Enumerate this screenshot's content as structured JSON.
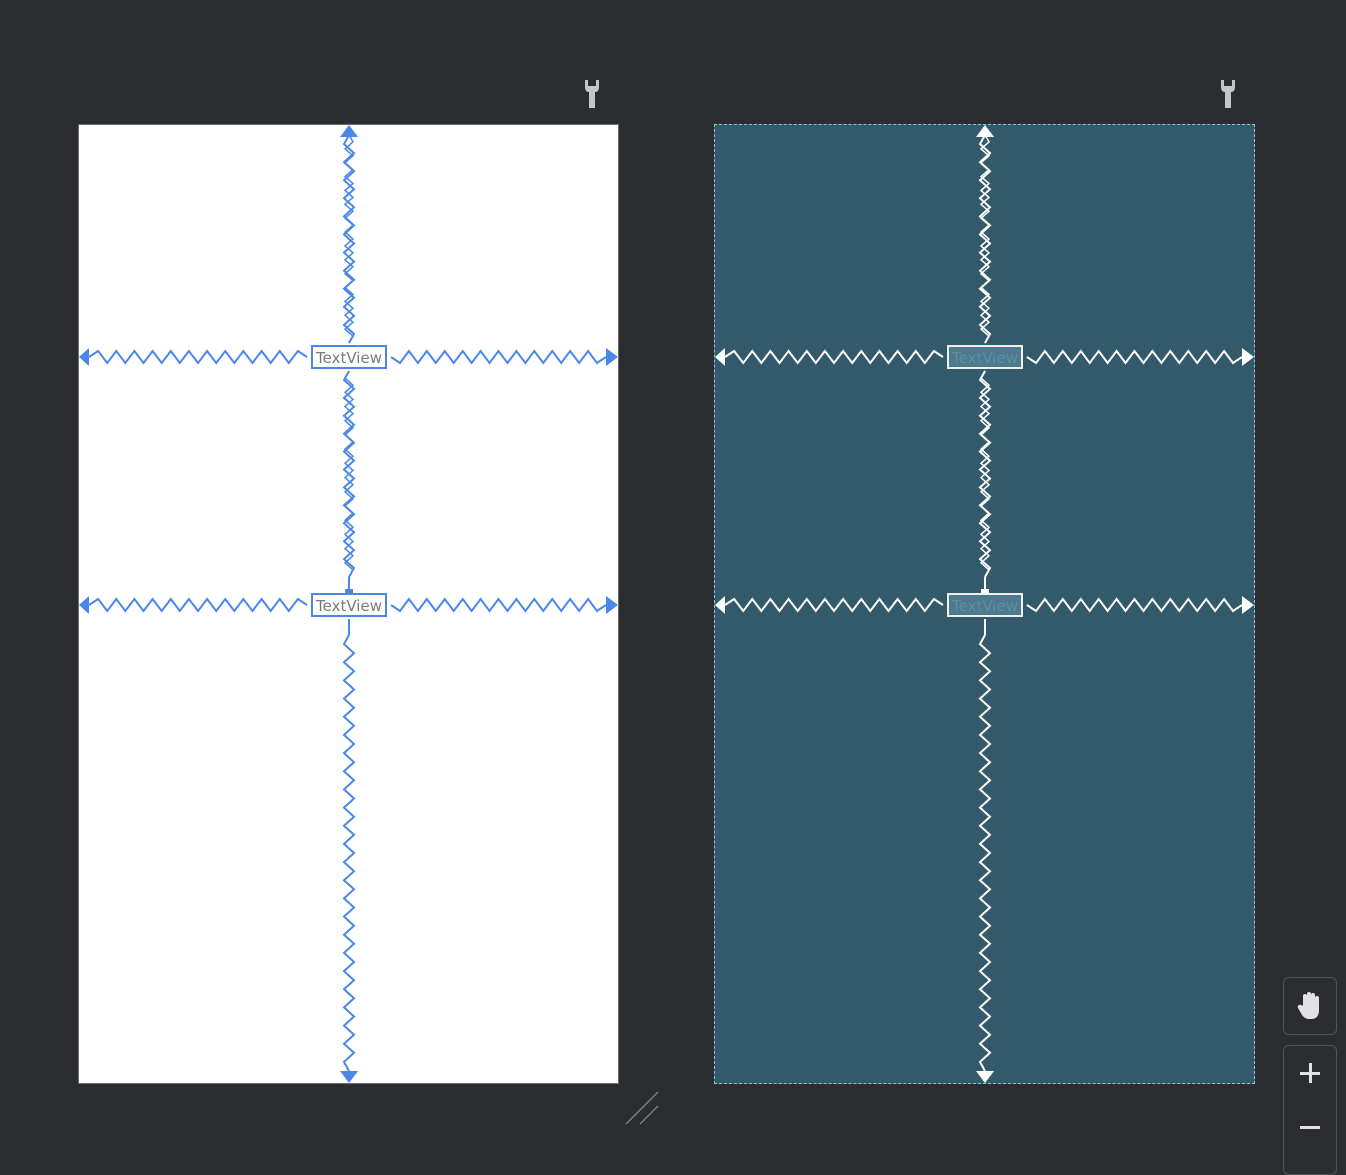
{
  "design_view": {
    "textview_1": "TextView",
    "textview_2": "TextView",
    "constraint_color": "#4a87e8",
    "background": "#ffffff"
  },
  "blueprint_view": {
    "textview_1": "TextView",
    "textview_2": "TextView",
    "constraint_color": "#ffffff",
    "background": "#325a6a"
  },
  "toolbar": {
    "pan_icon": "hand-icon",
    "zoom_in_icon": "plus-icon",
    "zoom_out_icon": "minus-icon"
  },
  "colors": {
    "canvas_background": "#2b2d30"
  }
}
